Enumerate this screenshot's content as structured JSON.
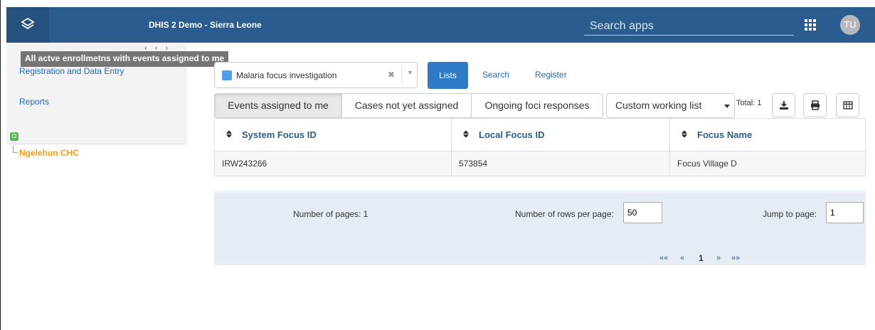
{
  "header": {
    "title": "DHIS 2 Demo - Sierra Leone",
    "search_placeholder": "Search apps",
    "avatar_initials": "TU"
  },
  "sidebar": {
    "tooltip": "All actve enrollmetns with events assigned to me",
    "links": [
      {
        "label": "Registration and Data Entry"
      },
      {
        "label": "Reports"
      }
    ],
    "org_unit": "Ngelehun CHC"
  },
  "program": {
    "selected": "Malaria focus investigation",
    "clear_glyph": "✖",
    "arrow_glyph": "▼"
  },
  "top_actions": {
    "lists": "Lists",
    "search": "Search",
    "register": "Register"
  },
  "working_lists": {
    "tabs": [
      {
        "label": "Events assigned to me",
        "active": true
      },
      {
        "label": "Cases not yet assigned",
        "active": false
      },
      {
        "label": "Ongoing foci responses",
        "active": false
      },
      {
        "label": "Custom working list",
        "active": false
      }
    ],
    "total": "Total: 1"
  },
  "table": {
    "columns": [
      "System Focus ID",
      "Local Focus ID",
      "Focus Name"
    ],
    "rows": [
      [
        "IRW243266",
        "573854",
        "Focus Village D"
      ]
    ]
  },
  "pager": {
    "pages_label": "Number of pages: 1",
    "rows_label": "Number of rows per page:",
    "rows_value": "50",
    "jump_label": "Jump to page:",
    "jump_value": "1",
    "first": "««",
    "prev": "«",
    "current": "1",
    "next": "»",
    "last": "»»"
  },
  "colors": {
    "header": "#2a5c8f",
    "primary_button": "#2f7ac6",
    "org_unit": "#f39c12",
    "link": "#2068b8"
  }
}
